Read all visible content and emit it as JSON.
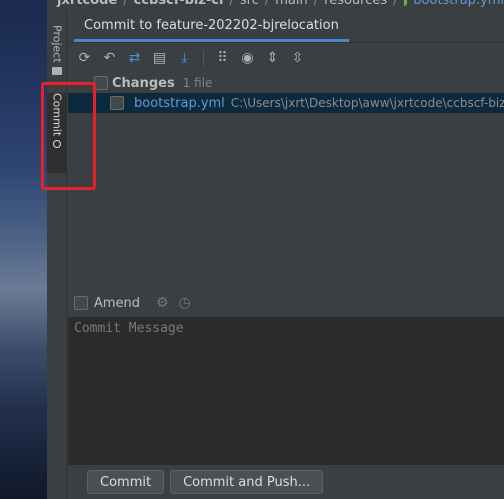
{
  "breadcrumb": {
    "items": [
      "jxrtcode",
      "ccbscf-biz-ci",
      "src",
      "main",
      "resources"
    ],
    "file": "bootstrap.yml",
    "separator": "/"
  },
  "stripe": {
    "project_label": "Project",
    "commit_label": "Commit"
  },
  "panel": {
    "tab_label": "Commit to feature-202202-bjrelocation"
  },
  "toolbar": {
    "icons": [
      "refresh-icon",
      "rollback-icon",
      "diff-icon",
      "shelve-icon",
      "update-icon",
      "group-by-icon",
      "view-options-icon",
      "expand-all-icon",
      "collapse-all-icon"
    ]
  },
  "changes": {
    "label": "Changes",
    "count": "1 file",
    "file_name": "bootstrap.yml",
    "file_path": "C:\\Users\\jxrt\\Desktop\\aww\\jxrtcode\\ccbscf-biz"
  },
  "amend": {
    "label": "Amend"
  },
  "message": {
    "placeholder": "Commit Message"
  },
  "buttons": {
    "commit": "Commit",
    "commit_push": "Commit and Push..."
  },
  "colors": {
    "highlight": "#e8202a",
    "accent": "#4a88c7",
    "file_name": "#5e9cd3",
    "yaml_leaf": "#62b543"
  }
}
